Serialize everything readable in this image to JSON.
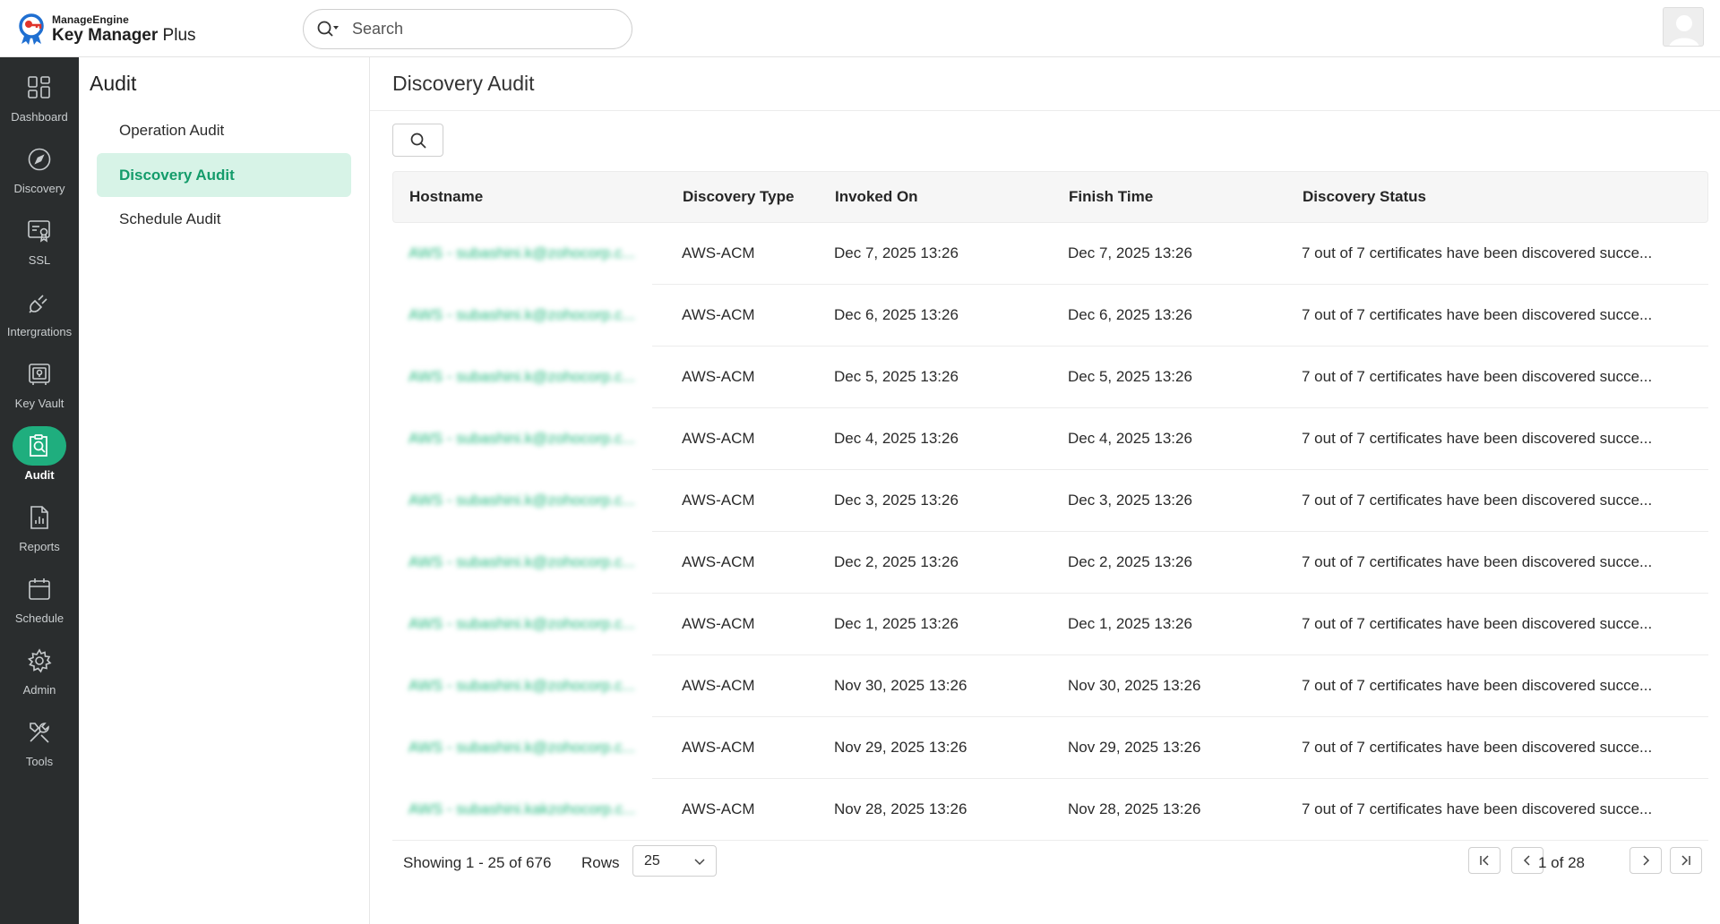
{
  "app": {
    "brand": "ManageEngine",
    "product_main": "Key Manager",
    "product_suffix": " Plus"
  },
  "search": {
    "placeholder": "Search"
  },
  "rail": {
    "items": [
      {
        "label": "Dashboard",
        "icon": "dashboard-icon"
      },
      {
        "label": "Discovery",
        "icon": "compass-icon"
      },
      {
        "label": "SSL",
        "icon": "ssl-certificate-icon"
      },
      {
        "label": "Intergrations",
        "icon": "plug-icon"
      },
      {
        "label": "Key Vault",
        "icon": "vault-icon"
      },
      {
        "label": "Audit",
        "icon": "audit-icon",
        "active": true
      },
      {
        "label": "Reports",
        "icon": "report-icon"
      },
      {
        "label": "Schedule",
        "icon": "calendar-icon"
      },
      {
        "label": "Admin",
        "icon": "gear-icon"
      },
      {
        "label": "Tools",
        "icon": "tools-icon"
      }
    ]
  },
  "subnav": {
    "title": "Audit",
    "items": [
      {
        "label": "Operation Audit"
      },
      {
        "label": "Discovery Audit",
        "active": true
      },
      {
        "label": "Schedule Audit"
      }
    ]
  },
  "main": {
    "title": "Discovery Audit",
    "columns": [
      "Hostname",
      "Discovery Type",
      "Invoked On",
      "Finish Time",
      "Discovery Status"
    ],
    "rows": [
      {
        "host": "AWS - subashini.k@zohocorp.c...",
        "type": "AWS-ACM",
        "invoked": "Dec 7, 2025 13:26",
        "finish": "Dec 7, 2025 13:26",
        "status": "7 out of 7 certificates have been discovered succe..."
      },
      {
        "host": "AWS - subashini.k@zohocorp.c...",
        "type": "AWS-ACM",
        "invoked": "Dec 6, 2025 13:26",
        "finish": "Dec 6, 2025 13:26",
        "status": "7 out of 7 certificates have been discovered succe..."
      },
      {
        "host": "AWS - subashini.k@zohocorp.c...",
        "type": "AWS-ACM",
        "invoked": "Dec 5, 2025 13:26",
        "finish": "Dec 5, 2025 13:26",
        "status": "7 out of 7 certificates have been discovered succe..."
      },
      {
        "host": "AWS - subashini.k@zohocorp.c...",
        "type": "AWS-ACM",
        "invoked": "Dec 4, 2025 13:26",
        "finish": "Dec 4, 2025 13:26",
        "status": "7 out of 7 certificates have been discovered succe..."
      },
      {
        "host": "AWS - subashini.k@zohocorp.c...",
        "type": "AWS-ACM",
        "invoked": "Dec 3, 2025 13:26",
        "finish": "Dec 3, 2025 13:26",
        "status": "7 out of 7 certificates have been discovered succe..."
      },
      {
        "host": "AWS - subashini.k@zohocorp.c...",
        "type": "AWS-ACM",
        "invoked": "Dec 2, 2025 13:26",
        "finish": "Dec 2, 2025 13:26",
        "status": "7 out of 7 certificates have been discovered succe..."
      },
      {
        "host": "AWS - subashini.k@zohocorp.c...",
        "type": "AWS-ACM",
        "invoked": "Dec 1, 2025 13:26",
        "finish": "Dec 1, 2025 13:26",
        "status": "7 out of 7 certificates have been discovered succe..."
      },
      {
        "host": "AWS - subashini.k@zohocorp.c...",
        "type": "AWS-ACM",
        "invoked": "Nov 30, 2025 13:26",
        "finish": "Nov 30, 2025 13:26",
        "status": "7 out of 7 certificates have been discovered succe..."
      },
      {
        "host": "AWS - subashini.k@zohocorp.c...",
        "type": "AWS-ACM",
        "invoked": "Nov 29, 2025 13:26",
        "finish": "Nov 29, 2025 13:26",
        "status": "7 out of 7 certificates have been discovered succe..."
      },
      {
        "host": "AWS - subashini.kakzohocorp.c...",
        "type": "AWS-ACM",
        "invoked": "Nov 28, 2025 13:26",
        "finish": "Nov 28, 2025 13:26",
        "status": "7 out of 7 certificates have been discovered succe..."
      }
    ],
    "footer": {
      "showing": "Showing 1 - 25 of 676",
      "rows_label": "Rows",
      "rows_value": "25",
      "page_text": "1 of 28"
    }
  },
  "colors": {
    "accent": "#1fae7e",
    "rail_bg": "#2a2d2e",
    "active_bg": "#d7f3e7",
    "active_text": "#149c6b"
  }
}
